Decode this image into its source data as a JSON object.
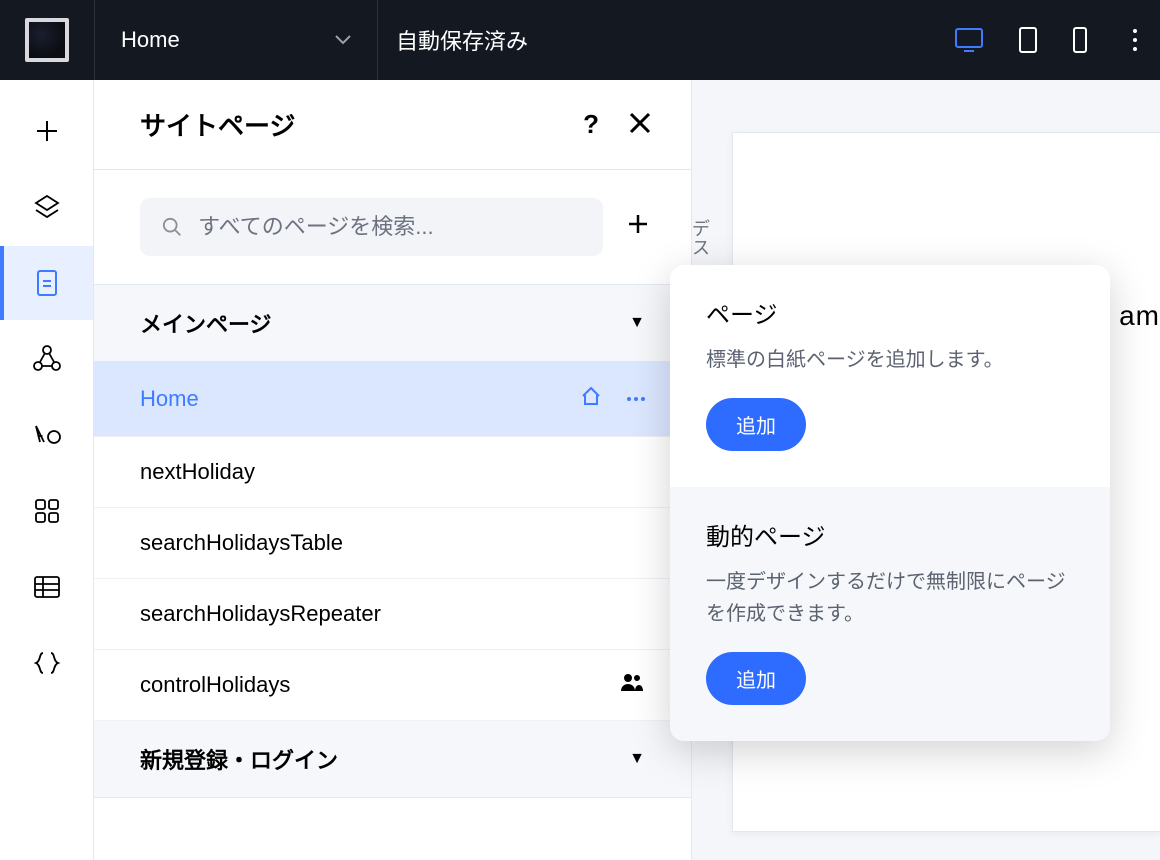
{
  "topbar": {
    "page_name": "Home",
    "save_status": "自動保存済み"
  },
  "panel": {
    "title": "サイトページ",
    "search_placeholder": "すべてのページを検索...",
    "sections": {
      "main": {
        "label": "メインページ",
        "pages": [
          {
            "name": "Home",
            "is_home": true,
            "selected": true
          },
          {
            "name": "nextHoliday"
          },
          {
            "name": "searchHolidaysTable"
          },
          {
            "name": "searchHolidaysRepeater"
          },
          {
            "name": "controlHolidays",
            "members": true
          }
        ]
      },
      "auth": {
        "label": "新規登録・ログイン"
      }
    }
  },
  "popup": {
    "page": {
      "title": "ページ",
      "desc": "標準の白紙ページを追加します。",
      "button": "追加"
    },
    "dynamic": {
      "title": "動的ページ",
      "desc": "一度デザインするだけで無制限にページを作成できます。",
      "button": "追加"
    }
  },
  "canvas": {
    "side_text": "デス",
    "hint_fragment": "am"
  }
}
